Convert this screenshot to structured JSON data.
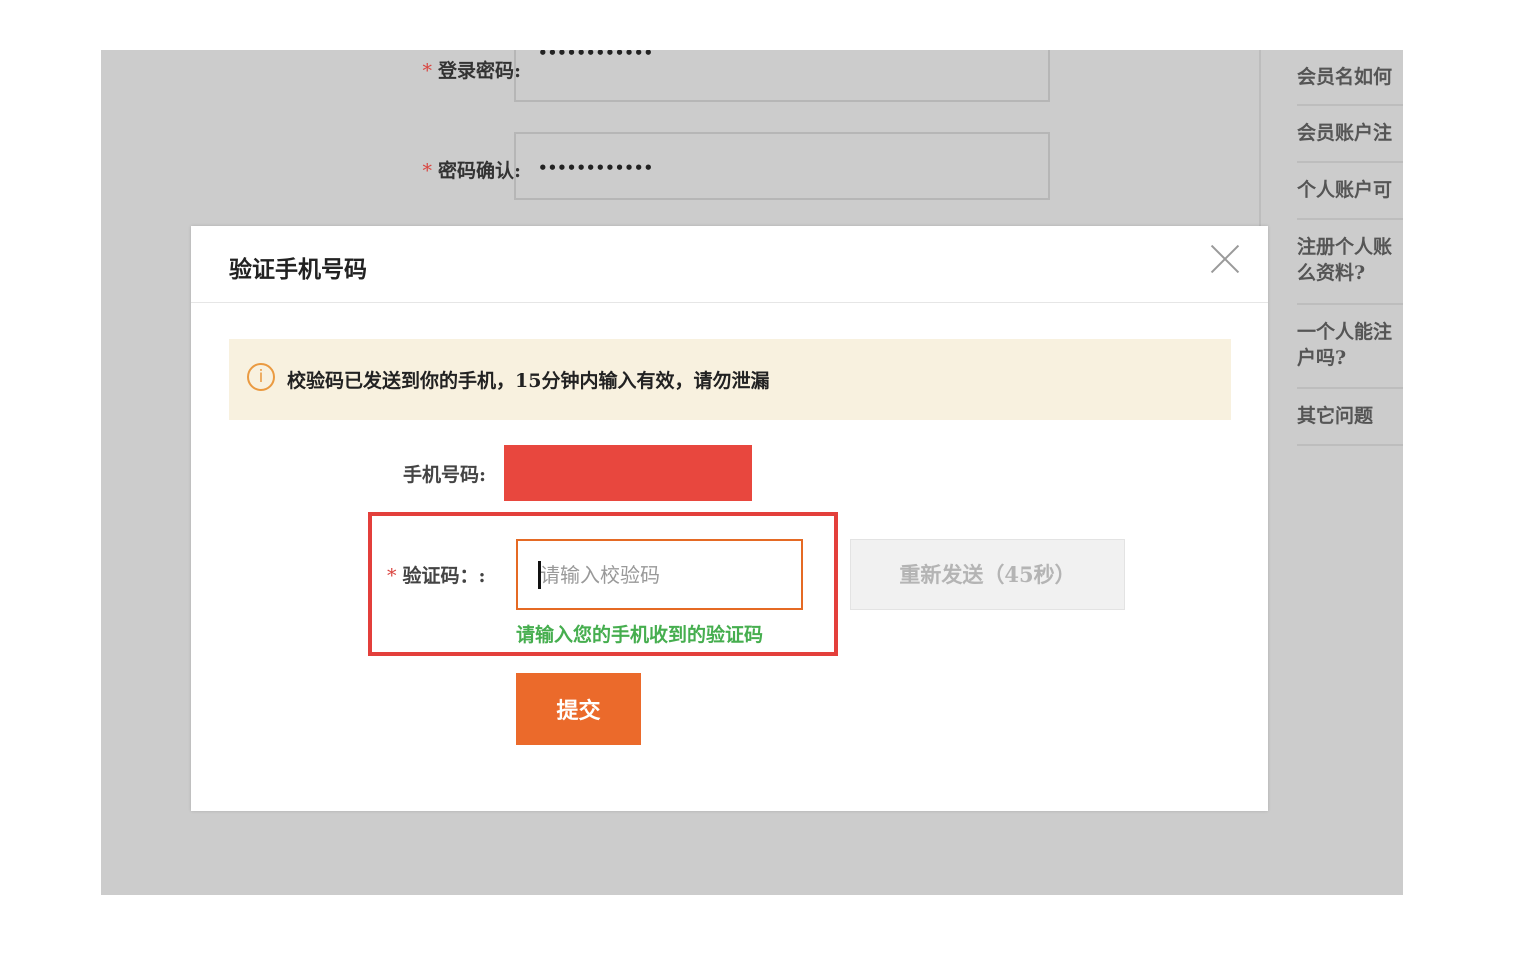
{
  "background_form": {
    "fields": [
      {
        "required_mark": "*",
        "label": "登录密码:",
        "value": "••••••••••••"
      },
      {
        "required_mark": "*",
        "label": "密码确认:",
        "value": "••••••••••••"
      }
    ]
  },
  "sidebar": {
    "items": [
      {
        "label": "会员名如何"
      },
      {
        "label": "会员账户注"
      },
      {
        "label": "个人账户可"
      },
      {
        "label": "注册个人账",
        "label_line2": "么资料?"
      },
      {
        "label": "一个人能注",
        "label_line2": "户吗?"
      },
      {
        "label": "其它问题"
      }
    ]
  },
  "modal": {
    "title": "验证手机号码",
    "notice": {
      "icon": "info-icon",
      "icon_glyph": "i",
      "text": "校验码已发送到你的手机，15分钟内输入有效，请勿泄漏"
    },
    "phone": {
      "label": "手机号码:",
      "value": ""
    },
    "code": {
      "required_mark": "*",
      "label": "验证码：:",
      "value": "",
      "placeholder": "请输入校验码",
      "hint": "请输入您的手机收到的验证码"
    },
    "resend_label": "重新发送（45秒）",
    "submit_label": "提交"
  },
  "colors": {
    "accent": "#eb6a2b",
    "redaction": "#e8473e",
    "highlight": "#e33f3b",
    "hint_green": "#46ae4f",
    "notice_bg": "#f8f1df"
  }
}
